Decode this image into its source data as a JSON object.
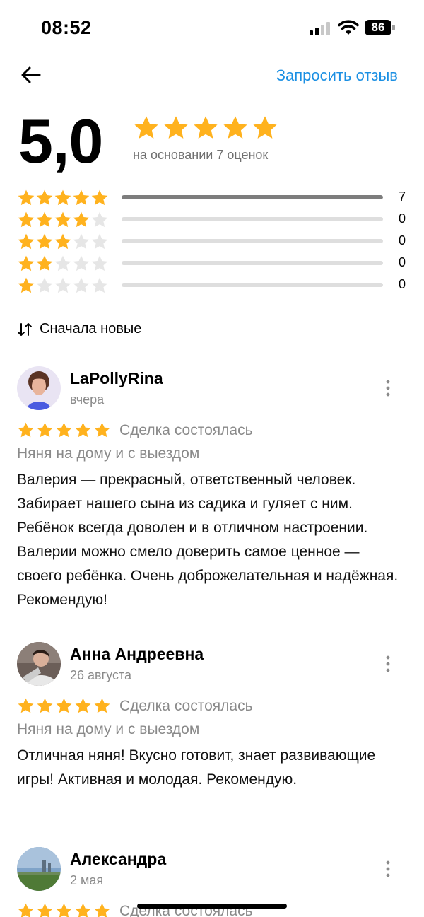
{
  "status_bar": {
    "time": "08:52",
    "battery": "86"
  },
  "header": {
    "request_review": "Запросить отзыв"
  },
  "summary": {
    "rating": "5,0",
    "rating_value": 5,
    "based_on": "на основании 7 оценок",
    "histogram": [
      {
        "stars": 5,
        "count": "7",
        "fraction": 1.0
      },
      {
        "stars": 4,
        "count": "0",
        "fraction": 0
      },
      {
        "stars": 3,
        "count": "0",
        "fraction": 0
      },
      {
        "stars": 2,
        "count": "0",
        "fraction": 0
      },
      {
        "stars": 1,
        "count": "0",
        "fraction": 0
      }
    ]
  },
  "sort": {
    "label": "Сначала новые"
  },
  "reviews": [
    {
      "author": "LaPollyRina",
      "date": "вчера",
      "stars": 5,
      "deal": "Сделка состоялась",
      "service": "Няня на дому и с выездом",
      "text": "Валерия — прекрасный, ответственный человек. Забирает нашего сына из садика и гуляет с ним. Ребёнок всегда доволен и в отличном настроении. Валерии можно смело доверить самое ценное — своего ребёнка. Очень доброжелательная и надёжная. Рекомендую!"
    },
    {
      "author": "Анна Андреевна",
      "date": "26 августа",
      "stars": 5,
      "deal": "Сделка состоялась",
      "service": "Няня на дому и с выездом",
      "text": "Отличная няня! Вкусно готовит, знает развивающие игры! Активная и молодая. Рекомендую."
    },
    {
      "author": "Александра",
      "date": "2 мая",
      "stars": 5,
      "deal": "Сделка состоялась"
    }
  ],
  "colors": {
    "star": "#ffb21e",
    "star_empty": "#e6e6e6",
    "link": "#1a8fe3",
    "muted": "#8a8a8a"
  },
  "icons": [
    "back-arrow-icon",
    "signal-icon",
    "wifi-icon",
    "battery-icon",
    "sort-icon",
    "star-icon",
    "more-icon"
  ]
}
